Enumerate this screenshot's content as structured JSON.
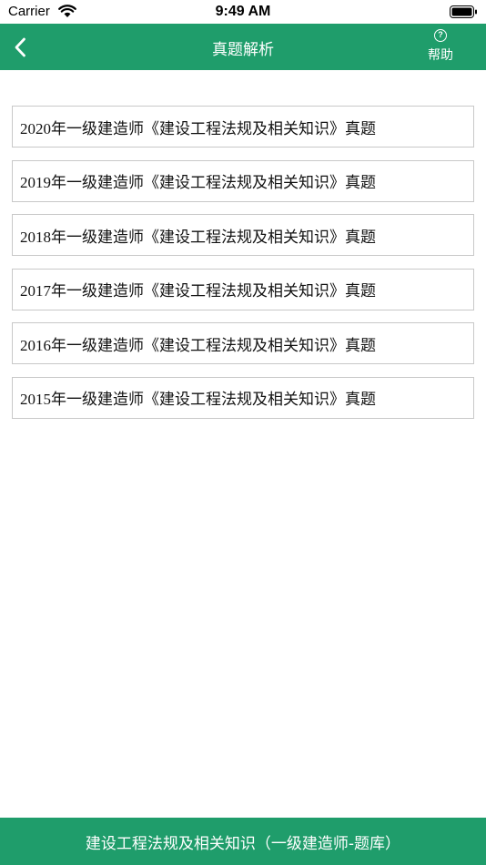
{
  "status_bar": {
    "carrier": "Carrier",
    "time": "9:49 AM"
  },
  "nav": {
    "title": "真题解析",
    "help_label": "帮助",
    "help_icon_glyph": "?"
  },
  "exam_list": [
    {
      "label": "2020年一级建造师《建设工程法规及相关知识》真题"
    },
    {
      "label": "2019年一级建造师《建设工程法规及相关知识》真题"
    },
    {
      "label": "2018年一级建造师《建设工程法规及相关知识》真题"
    },
    {
      "label": "2017年一级建造师《建设工程法规及相关知识》真题"
    },
    {
      "label": "2016年一级建造师《建设工程法规及相关知识》真题"
    },
    {
      "label": "2015年一级建造师《建设工程法规及相关知识》真题"
    }
  ],
  "bottom_bar": {
    "label": "建设工程法规及相关知识（一级建造师-题库）"
  },
  "colors": {
    "brand_green": "#1f9d6b",
    "item_border": "#c8c8c8"
  }
}
